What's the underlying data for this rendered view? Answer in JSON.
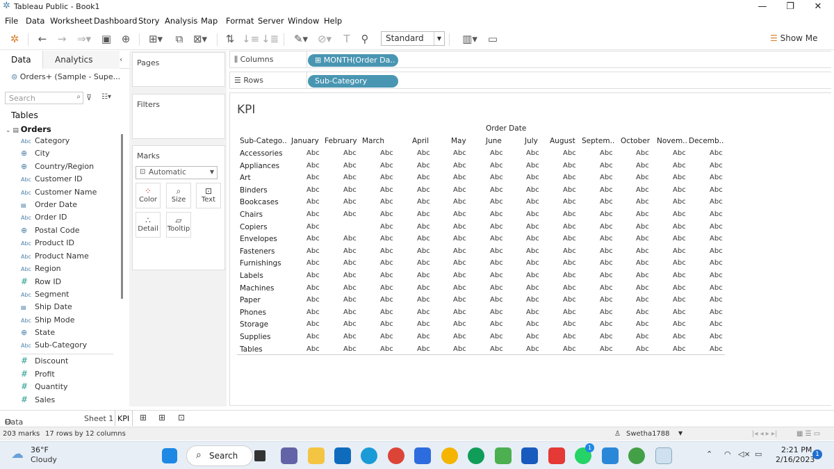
{
  "window": {
    "title": "Tableau Public - Book1"
  },
  "menu": [
    "File",
    "Data",
    "Worksheet",
    "Dashboard",
    "Story",
    "Analysis",
    "Map",
    "Format",
    "Server",
    "Window",
    "Help"
  ],
  "toolbar": {
    "fit_select": "Standard",
    "show_me": "Show Me"
  },
  "datapane": {
    "tab_data": "Data",
    "tab_analytics": "Analytics",
    "datasource": "Orders+ (Sample - Supe...",
    "search_placeholder": "Search",
    "tables_heading": "Tables",
    "table_name": "Orders",
    "dimensions": [
      {
        "type": "Abc",
        "name": "Category"
      },
      {
        "type": "geo",
        "name": "City"
      },
      {
        "type": "geo",
        "name": "Country/Region"
      },
      {
        "type": "Abc",
        "name": "Customer ID"
      },
      {
        "type": "Abc",
        "name": "Customer Name"
      },
      {
        "type": "date",
        "name": "Order Date"
      },
      {
        "type": "Abc",
        "name": "Order ID"
      },
      {
        "type": "geo",
        "name": "Postal Code"
      },
      {
        "type": "Abc",
        "name": "Product ID"
      },
      {
        "type": "Abc",
        "name": "Product Name"
      },
      {
        "type": "Abc",
        "name": "Region"
      },
      {
        "type": "#",
        "name": "Row ID"
      },
      {
        "type": "Abc",
        "name": "Segment"
      },
      {
        "type": "date",
        "name": "Ship Date"
      },
      {
        "type": "Abc",
        "name": "Ship Mode"
      },
      {
        "type": "geo",
        "name": "State"
      },
      {
        "type": "Abc",
        "name": "Sub-Category"
      }
    ],
    "measures": [
      {
        "type": "#",
        "name": "Discount"
      },
      {
        "type": "#",
        "name": "Profit"
      },
      {
        "type": "#",
        "name": "Quantity"
      },
      {
        "type": "#",
        "name": "Sales"
      }
    ]
  },
  "cards": {
    "pages": "Pages",
    "filters": "Filters",
    "marks": "Marks",
    "mark_type": "Automatic",
    "mark_buttons": [
      "Color",
      "Size",
      "Text",
      "Detail",
      "Tooltip"
    ]
  },
  "shelves": {
    "columns_label": "Columns",
    "columns_pill": "MONTH(Order Da..",
    "rows_label": "Rows",
    "rows_pill": "Sub-Category"
  },
  "view": {
    "title": "KPI",
    "column_header": "Order Date",
    "row_header": "Sub-Catego..",
    "months": [
      "January",
      "February",
      "March",
      "April",
      "May",
      "June",
      "July",
      "August",
      "Septem..",
      "October",
      "Novem..",
      "Decemb.."
    ],
    "rows": [
      "Accessories",
      "Appliances",
      "Art",
      "Binders",
      "Bookcases",
      "Chairs",
      "Copiers",
      "Envelopes",
      "Fasteners",
      "Furnishings",
      "Labels",
      "Machines",
      "Paper",
      "Phones",
      "Storage",
      "Supplies",
      "Tables"
    ],
    "cell_text": "Abc",
    "missing_cells": [
      [
        6,
        1
      ]
    ]
  },
  "sheets": {
    "data_source": "Data Source",
    "sheet1": "Sheet 1",
    "kpi": "KPI"
  },
  "status": {
    "marks": "203 marks",
    "dims": "17 rows by 12 columns",
    "user": "Swetha1788"
  },
  "taskbar": {
    "temp": "36°F",
    "weather": "Cloudy",
    "search": "Search",
    "time": "2:21 PM",
    "date": "2/16/2023",
    "notif": "1"
  }
}
